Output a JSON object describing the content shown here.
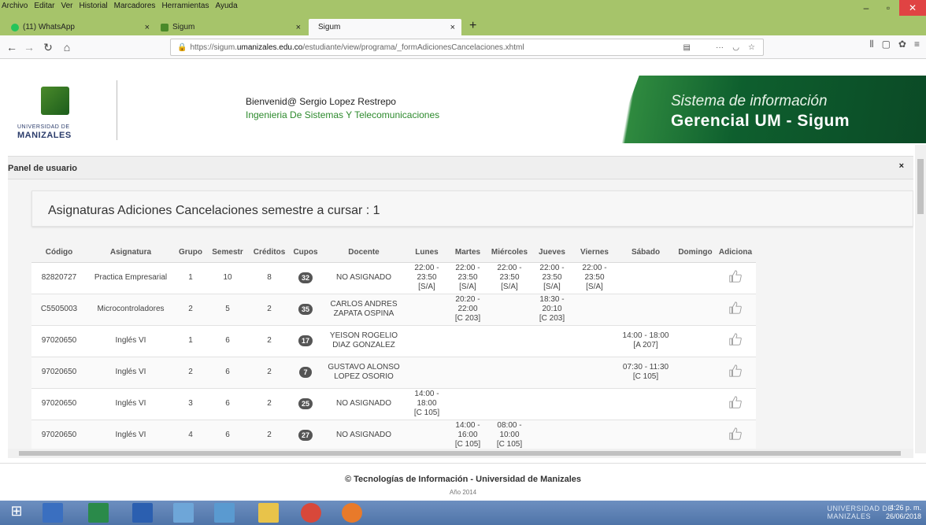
{
  "browser": {
    "menu": [
      "Archivo",
      "Editar",
      "Ver",
      "Historial",
      "Marcadores",
      "Herramientas",
      "Ayuda"
    ],
    "tabs": [
      {
        "label": "(11) WhatsApp",
        "icon": "whatsapp-icon"
      },
      {
        "label": "Sigum",
        "icon": "sigum-icon"
      },
      {
        "label": "Sigum",
        "icon": "none"
      }
    ],
    "url_prefix": "https://sigum.",
    "url_host": "umanizales.edu.co",
    "url_path": "/estudiante/view/programa/_formAdicionesCancelaciones.xhtml",
    "url_more": "···"
  },
  "header": {
    "logo_line1": "UNIVERSIDAD DE",
    "logo_line2": "MANIZALES",
    "welcome": "Bienvenid@ Sergio Lopez Restrepo",
    "program": "Ingenieria De Sistemas Y Telecomunicaciones",
    "banner_line1": "Sistema de información",
    "banner_line2": "Gerencial UM - Sigum"
  },
  "panel": {
    "title": "Panel de usuario",
    "close": "×",
    "card_title": "Asignaturas Adiciones Cancelaciones semestre a cursar : 1"
  },
  "table": {
    "columns": [
      "Código",
      "Asignatura",
      "Grupo",
      "Semestr",
      "Créditos",
      "Cupos",
      "Docente",
      "Lunes",
      "Martes",
      "Miércoles",
      "Jueves",
      "Viernes",
      "Sábado",
      "Domingo",
      "Adiciona"
    ],
    "rows": [
      {
        "codigo": "82820727",
        "asignatura": "Practica Empresarial",
        "grupo": "1",
        "semestre": "10",
        "creditos": "8",
        "cupos": "32",
        "docente": "NO ASIGNADO",
        "lunes": "22:00 - 23:50\n[S/A]",
        "martes": "22:00 - 23:50\n[S/A]",
        "miercoles": "22:00 - 23:50\n[S/A]",
        "jueves": "22:00 - 23:50\n[S/A]",
        "viernes": "22:00 - 23:50\n[S/A]",
        "sabado": "",
        "domingo": ""
      },
      {
        "codigo": "C5505003",
        "asignatura": "Microcontroladores",
        "grupo": "2",
        "semestre": "5",
        "creditos": "2",
        "cupos": "35",
        "docente": "CARLOS ANDRES\nZAPATA OSPINA",
        "lunes": "",
        "martes": "20:20 - 22:00\n[C 203]",
        "miercoles": "",
        "jueves": "18:30 - 20:10\n[C 203]",
        "viernes": "",
        "sabado": "",
        "domingo": ""
      },
      {
        "codigo": "97020650",
        "asignatura": "Inglés VI",
        "grupo": "1",
        "semestre": "6",
        "creditos": "2",
        "cupos": "17",
        "docente": "YEISON ROGELIO\nDIAZ GONZALEZ",
        "lunes": "",
        "martes": "",
        "miercoles": "",
        "jueves": "",
        "viernes": "",
        "sabado": "14:00 - 18:00\n[A 207]",
        "domingo": ""
      },
      {
        "codigo": "97020650",
        "asignatura": "Inglés VI",
        "grupo": "2",
        "semestre": "6",
        "creditos": "2",
        "cupos": "7",
        "docente": "GUSTAVO ALONSO\nLOPEZ OSORIO",
        "lunes": "",
        "martes": "",
        "miercoles": "",
        "jueves": "",
        "viernes": "",
        "sabado": "07:30 - 11:30\n[C 105]",
        "domingo": ""
      },
      {
        "codigo": "97020650",
        "asignatura": "Inglés VI",
        "grupo": "3",
        "semestre": "6",
        "creditos": "2",
        "cupos": "25",
        "docente": "NO ASIGNADO",
        "lunes": "14:00 - 18:00\n[C 105]",
        "martes": "",
        "miercoles": "",
        "jueves": "",
        "viernes": "",
        "sabado": "",
        "domingo": ""
      },
      {
        "codigo": "97020650",
        "asignatura": "Inglés VI",
        "grupo": "4",
        "semestre": "6",
        "creditos": "2",
        "cupos": "27",
        "docente": "NO ASIGNADO",
        "lunes": "",
        "martes": "14:00 - 16:00\n[C 105]",
        "miercoles": "08:00 - 10:00\n[C 105]",
        "jueves": "",
        "viernes": "",
        "sabado": "",
        "domingo": ""
      }
    ]
  },
  "footer": {
    "line1": "© Tecnologías de Información - Universidad de Manizales",
    "line2": "Año 2014"
  },
  "taskbar": {
    "brand1": "UNIVERSIDAD DE",
    "brand2": "MANIZALES",
    "time": "4:26 p. m.",
    "date": "26/06/2018"
  },
  "colors": {
    "chrome_green": "#a6c46a",
    "brand_green": "#0e5f2e",
    "program_green": "#2d8a2d"
  }
}
